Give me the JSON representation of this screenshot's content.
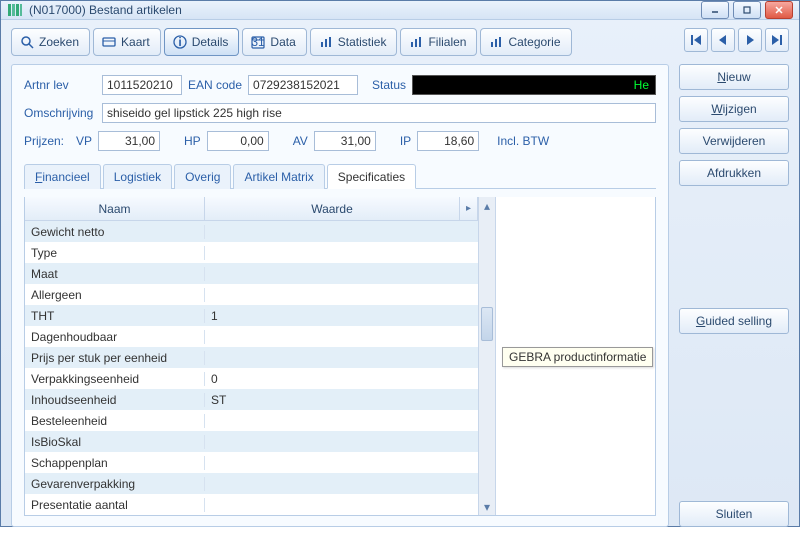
{
  "window": {
    "title": "(N017000) Bestand artikelen"
  },
  "toolbar": {
    "zoeken": "Zoeken",
    "kaart": "Kaart",
    "details": "Details",
    "data": "Data",
    "statistiek": "Statistiek",
    "filialen": "Filialen",
    "categorie": "Categorie"
  },
  "header": {
    "artnr_lbl": "Artnr lev",
    "artnr_val": "1011520210",
    "ean_lbl": "EAN code",
    "ean_val": "0729238152021",
    "status_lbl": "Status",
    "status_val": "He",
    "omschr_lbl": "Omschrijving",
    "omschr_val": "shiseido gel lipstick 225 high rise",
    "prijzen_lbl": "Prijzen:",
    "vp_lbl": "VP",
    "vp_val": "31,00",
    "hp_lbl": "HP",
    "hp_val": "0,00",
    "av_lbl": "AV",
    "av_val": "31,00",
    "ip_lbl": "IP",
    "ip_val": "18,60",
    "btw_lbl": "Incl. BTW"
  },
  "subtabs": {
    "financieel": "Financieel",
    "logistiek": "Logistiek",
    "overig": "Overig",
    "artikelmatrix": "Artikel Matrix",
    "specificaties": "Specificaties"
  },
  "grid": {
    "col_name": "Naam",
    "col_value": "Waarde",
    "col_corner": "▸",
    "rows": [
      {
        "name": "Gewicht netto",
        "value": ""
      },
      {
        "name": "Type",
        "value": ""
      },
      {
        "name": "Maat",
        "value": ""
      },
      {
        "name": "Allergeen",
        "value": ""
      },
      {
        "name": "THT",
        "value": "1"
      },
      {
        "name": "Dagenhoudbaar",
        "value": ""
      },
      {
        "name": "Prijs per stuk per eenheid",
        "value": ""
      },
      {
        "name": "Verpakkingseenheid",
        "value": "0"
      },
      {
        "name": "Inhoudseenheid",
        "value": "ST"
      },
      {
        "name": "Besteleenheid",
        "value": ""
      },
      {
        "name": "IsBioSkal",
        "value": ""
      },
      {
        "name": "Schappenplan",
        "value": ""
      },
      {
        "name": "Gevarenverpakking",
        "value": ""
      },
      {
        "name": "Presentatie aantal",
        "value": ""
      }
    ]
  },
  "tooltip": "GEBRA productinformatie",
  "buttons": {
    "nieuw": "Nieuw",
    "wijzigen": "Wijzigen",
    "verwijderen": "Verwijderen",
    "afdrukken": "Afdrukken",
    "guided": "Guided selling",
    "sluiten": "Sluiten"
  }
}
